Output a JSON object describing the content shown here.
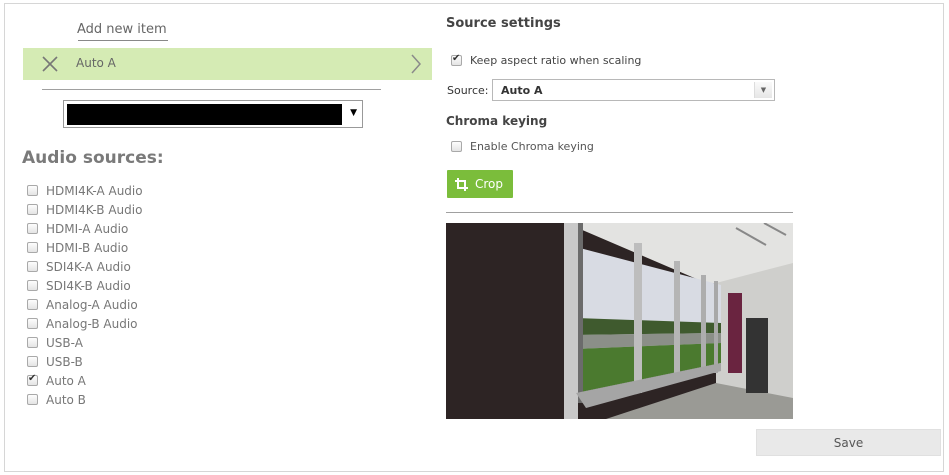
{
  "layout_list": {
    "add_new_label": "Add new item",
    "selected_item_label": "Auto A"
  },
  "audio": {
    "title": "Audio sources:",
    "items": [
      {
        "label": "HDMI4K-A Audio",
        "checked": false
      },
      {
        "label": "HDMI4K-B Audio",
        "checked": false
      },
      {
        "label": "HDMI-A Audio",
        "checked": false
      },
      {
        "label": "HDMI-B Audio",
        "checked": false
      },
      {
        "label": "SDI4K-A Audio",
        "checked": false
      },
      {
        "label": "SDI4K-B Audio",
        "checked": false
      },
      {
        "label": "Analog-A Audio",
        "checked": false
      },
      {
        "label": "Analog-B Audio",
        "checked": false
      },
      {
        "label": "USB-A",
        "checked": false
      },
      {
        "label": "USB-B",
        "checked": false
      },
      {
        "label": "Auto A",
        "checked": true
      },
      {
        "label": "Auto B",
        "checked": false
      }
    ]
  },
  "source_settings": {
    "title": "Source settings",
    "keep_aspect_label": "Keep aspect ratio when scaling",
    "keep_aspect_checked": true,
    "source_label": "Source:",
    "source_value": "Auto A"
  },
  "chroma": {
    "title": "Chroma keying",
    "enable_label": "Enable Chroma keying",
    "enable_checked": false
  },
  "crop_label": "Crop",
  "save_label": "Save",
  "colors": {
    "accent_green": "#7bbd3b",
    "selected_row": "#d5ebb4"
  }
}
